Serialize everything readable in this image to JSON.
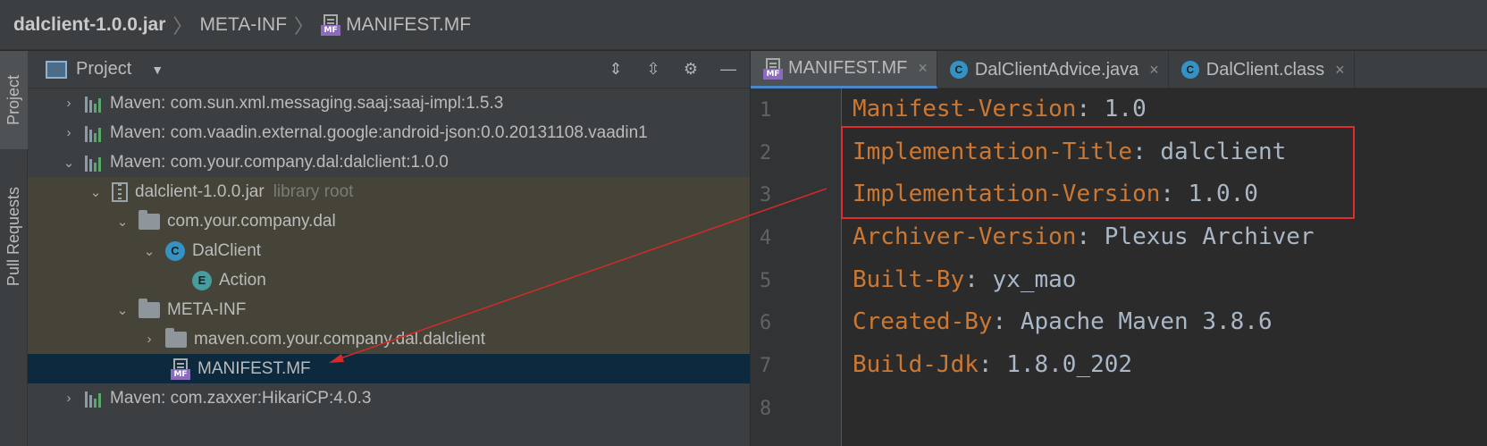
{
  "breadcrumb": {
    "items": [
      "dalclient-1.0.0.jar",
      "META-INF",
      "MANIFEST.MF"
    ],
    "mf_tag": "MF"
  },
  "left_toolbar": {
    "tabs": [
      "Project",
      "Pull Requests"
    ]
  },
  "project_panel": {
    "title": "Project",
    "tools": [
      "expand-all-icon",
      "collapse-all-icon",
      "gear-icon",
      "minimize-icon"
    ],
    "tree": [
      {
        "label": "Maven: com.sun.xml.messaging.saaj:saaj-impl:1.5.3",
        "type": "library",
        "arrow": "›"
      },
      {
        "label": "Maven: com.vaadin.external.google:android-json:0.0.20131108.vaadin1",
        "type": "library",
        "arrow": "›"
      },
      {
        "label": "Maven: com.your.company.dal:dalclient:1.0.0",
        "type": "library",
        "arrow": "⌄"
      },
      {
        "label": "dalclient-1.0.0.jar",
        "suffix": "library root",
        "type": "jar",
        "arrow": "⌄"
      },
      {
        "label": "com.your.company.dal",
        "type": "folder",
        "arrow": "⌄"
      },
      {
        "label": "DalClient",
        "type": "class",
        "icon_letter": "C",
        "arrow": "⌄"
      },
      {
        "label": "Action",
        "type": "enum",
        "icon_letter": "E",
        "arrow": ""
      },
      {
        "label": "META-INF",
        "type": "folder",
        "arrow": "⌄"
      },
      {
        "label": "maven.com.your.company.dal.dalclient",
        "type": "folder",
        "arrow": "›"
      },
      {
        "label": "MANIFEST.MF",
        "type": "manifest",
        "arrow": "",
        "selected": true
      },
      {
        "label": "Maven: com.zaxxer:HikariCP:4.0.3",
        "type": "library",
        "arrow": "›"
      }
    ]
  },
  "editor": {
    "tabs": [
      {
        "label": "MANIFEST.MF",
        "icon": "MF",
        "active": true,
        "close": "×"
      },
      {
        "label": "DalClientAdvice.java",
        "icon": "C",
        "active": false,
        "close": "×"
      },
      {
        "label": "DalClient.class",
        "icon": "C",
        "active": false,
        "close": "×"
      }
    ],
    "line_numbers": [
      "1",
      "2",
      "3",
      "4",
      "5",
      "6",
      "7",
      "8"
    ],
    "lines": [
      {
        "key": "Manifest-Version",
        "value": ": 1.0"
      },
      {
        "key": "Implementation-Title",
        "value": ": dalclient"
      },
      {
        "key": "Implementation-Version",
        "value": ": 1.0.0"
      },
      {
        "key": "Archiver-Version",
        "value": ": Plexus Archiver"
      },
      {
        "key": "Built-By",
        "value": ": yx_mao"
      },
      {
        "key": "Created-By",
        "value": ": Apache Maven 3.8.6"
      },
      {
        "key": "Build-Jdk",
        "value": ": 1.8.0_202"
      }
    ]
  },
  "colors": {
    "annotation_red": "#e02c2c",
    "key": "#cc7832",
    "value": "#a9b7c6",
    "selection": "#0d293e"
  }
}
